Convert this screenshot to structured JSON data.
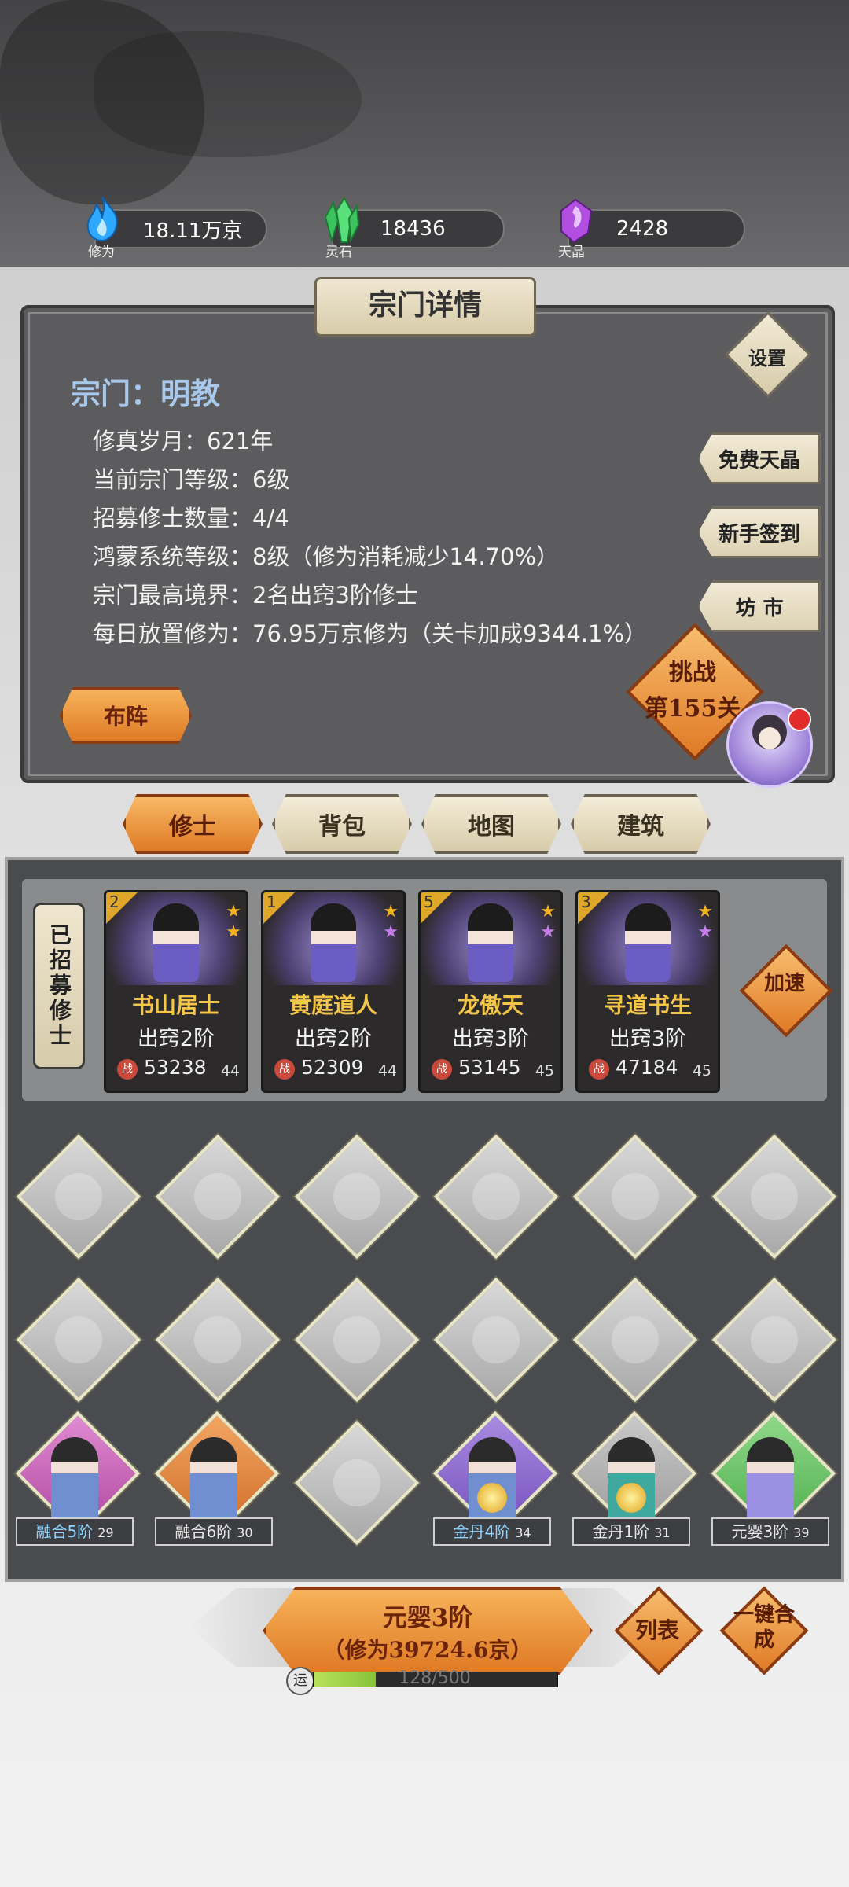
{
  "resources": [
    {
      "icon": "blue-flame-icon",
      "label": "修为",
      "value": "18.11万京",
      "color": "#2fa9ff"
    },
    {
      "icon": "green-crystal-icon",
      "label": "灵石",
      "value": "18436",
      "color": "#3bc45e"
    },
    {
      "icon": "purple-crystal-icon",
      "label": "天晶",
      "value": "2428",
      "color": "#b24fe0"
    }
  ],
  "panel": {
    "title": "宗门详情",
    "sect_name": "宗门：明教",
    "info_lines": [
      "修真岁月：621年",
      "当前宗门等级：6级",
      "招募修士数量：4/4",
      "鸿蒙系统等级：8级（修为消耗减少14.70%）",
      "宗门最高境界：2名出窍3阶修士",
      "每日放置修为：76.95万京修为（关卡加成9344.1%）"
    ],
    "settings_label": "设置",
    "side_buttons": [
      "免费天晶",
      "新手签到",
      "坊 市"
    ],
    "formation_label": "布阵",
    "challenge_line1": "挑战",
    "challenge_line2": "第155关"
  },
  "tabs": [
    {
      "label": "修士",
      "active": true
    },
    {
      "label": "背包",
      "active": false
    },
    {
      "label": "地图",
      "active": false
    },
    {
      "label": "建筑",
      "active": false
    }
  ],
  "recruited": {
    "title": "已招募修士",
    "speedup_label": "加速",
    "cards": [
      {
        "num": "2",
        "name": "书山居士",
        "realm": "出窍2阶",
        "power": "53238",
        "level": "44",
        "stars": [
          "#f3b31e",
          "#f3b31e"
        ]
      },
      {
        "num": "1",
        "name": "黄庭道人",
        "realm": "出窍2阶",
        "power": "52309",
        "level": "44",
        "stars": [
          "#f3b31e",
          "#c77de8"
        ]
      },
      {
        "num": "5",
        "name": "龙傲天",
        "realm": "出窍3阶",
        "power": "53145",
        "level": "45",
        "stars": [
          "#f3b31e",
          "#c77de8"
        ]
      },
      {
        "num": "3",
        "name": "寻道书生",
        "realm": "出窍3阶",
        "power": "47184",
        "level": "45",
        "stars": [
          "#f3b31e",
          "#c77de8"
        ]
      }
    ]
  },
  "units": [
    {
      "label": "融合5阶",
      "level": "29",
      "color": "#c95fb8",
      "label_color": "#8fd3ff"
    },
    {
      "label": "融合6阶",
      "level": "30",
      "color": "#e38a3e",
      "label_color": "#f0f0f0"
    },
    {
      "label": "金丹4阶",
      "level": "34",
      "color": "#8e6ad0",
      "label_color": "#8fd3ff"
    },
    {
      "label": "金丹1阶",
      "level": "31",
      "color": "#58b7a8",
      "label_color": "#f0f0f0"
    },
    {
      "label": "元婴3阶",
      "level": "39",
      "color": "#6cc46a",
      "label_color": "#f0f0f0"
    }
  ],
  "bottom": {
    "main_line1": "元婴3阶",
    "main_line2": "（修为39724.6京）",
    "list_label": "列表",
    "merge_label": "一键合成",
    "luck_label": "运",
    "luck_text": "128/500",
    "luck_fraction": 0.256
  }
}
